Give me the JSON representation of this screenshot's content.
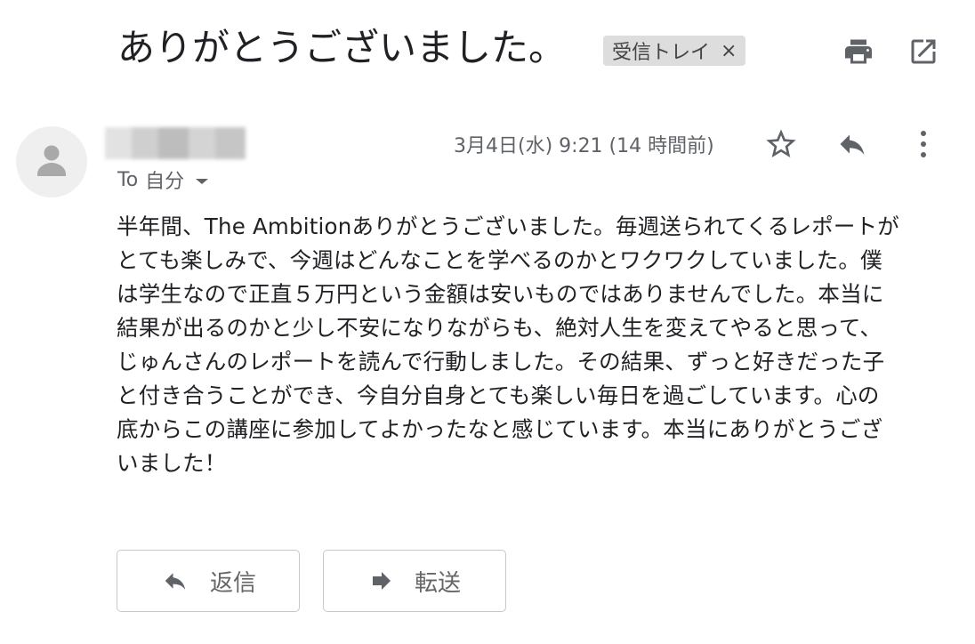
{
  "email": {
    "subject": "ありがとうございました。",
    "label_chip": "受信トレイ",
    "label_chip_close": "×",
    "recipient_prefix": "To",
    "recipient": "自分",
    "date": "3月4日(水) 9:21 (14 時間前)",
    "body": "半年間、The Ambitionありがとうございました。毎週送られてくるレポートが\nとても楽しみで、今週はどんなことを学べるのかとワクワクしていました。僕\nは学生なので正直５万円という金額は安いものではありませんでした。本当に\n結果が出るのかと少し不安になりながらも、絶対人生を変えてやると思って、\nじゅんさんのレポートを読んで行動しました。その結果、ずっと好きだった子\nと付き合うことができ、今自分自身とても楽しい毎日を過ごしています。心の\n底からこの講座に参加してよかったなと感じています。本当にありがとうござ\nいました！"
  },
  "actions": {
    "reply_label": "返信",
    "forward_label": "転送"
  },
  "icons": {
    "print": "print-icon",
    "open_new_window": "open-in-new-window-icon",
    "star": "star-icon",
    "reply": "reply-icon",
    "more": "more-vert-icon",
    "forward": "forward-icon",
    "avatar": "person-avatar-icon",
    "dropdown": "caret-down-icon"
  },
  "colors": {
    "text": "#202124",
    "secondary": "#5f6368",
    "chip_bg": "#dddddd",
    "icon": "#5f6368"
  }
}
